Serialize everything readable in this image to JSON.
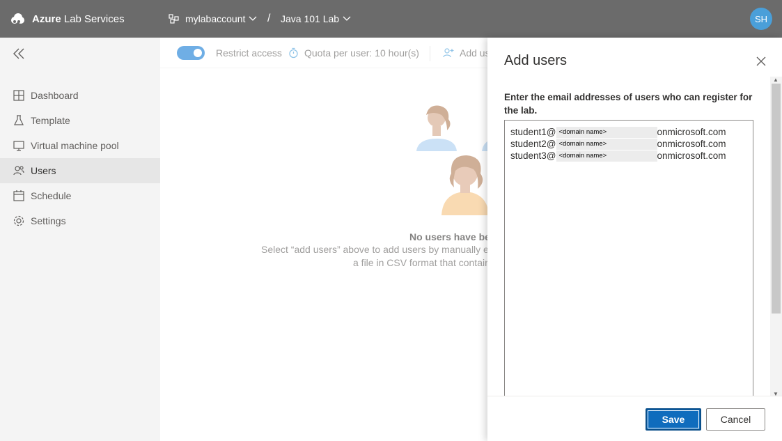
{
  "brand": {
    "name_bold": "Azure",
    "name_rest": "Lab Services"
  },
  "breadcrumb": {
    "account": "mylabaccount",
    "separator": "/",
    "lab": "Java 101 Lab"
  },
  "user": {
    "initials": "SH"
  },
  "sidebar": {
    "items": [
      {
        "label": "Dashboard",
        "icon": "dashboard-icon"
      },
      {
        "label": "Template",
        "icon": "flask-icon"
      },
      {
        "label": "Virtual machine pool",
        "icon": "monitor-icon"
      },
      {
        "label": "Users",
        "icon": "users-icon",
        "active": true
      },
      {
        "label": "Schedule",
        "icon": "calendar-icon"
      },
      {
        "label": "Settings",
        "icon": "gear-icon"
      }
    ]
  },
  "commandbar": {
    "restrict_access": "Restrict access",
    "restrict_enabled": true,
    "quota": "Quota per user: 10 hour(s)",
    "add_users": "Add us"
  },
  "empty_state": {
    "title": "No users have be",
    "line1": "Select “add users” above to add users by manually er",
    "line2": "a file in CSV format that contain"
  },
  "panel": {
    "title": "Add users",
    "description": "Enter the email addresses of users who can register for the lab.",
    "emails": [
      {
        "user": "student1@",
        "domain": "<domain name>",
        "suffix": "onmicrosoft.com"
      },
      {
        "user": "student2@",
        "domain": "<domain name>",
        "suffix": "onmicrosoft.com"
      },
      {
        "user": "student3@",
        "domain": "<domain name>",
        "suffix": "onmicrosoft.com"
      }
    ],
    "save_label": "Save",
    "cancel_label": "Cancel"
  },
  "colors": {
    "topbar": "#6b6b6b",
    "accent": "#0f6cbd",
    "avatar": "#4a9fd9",
    "sidebar": "#f4f4f4"
  }
}
